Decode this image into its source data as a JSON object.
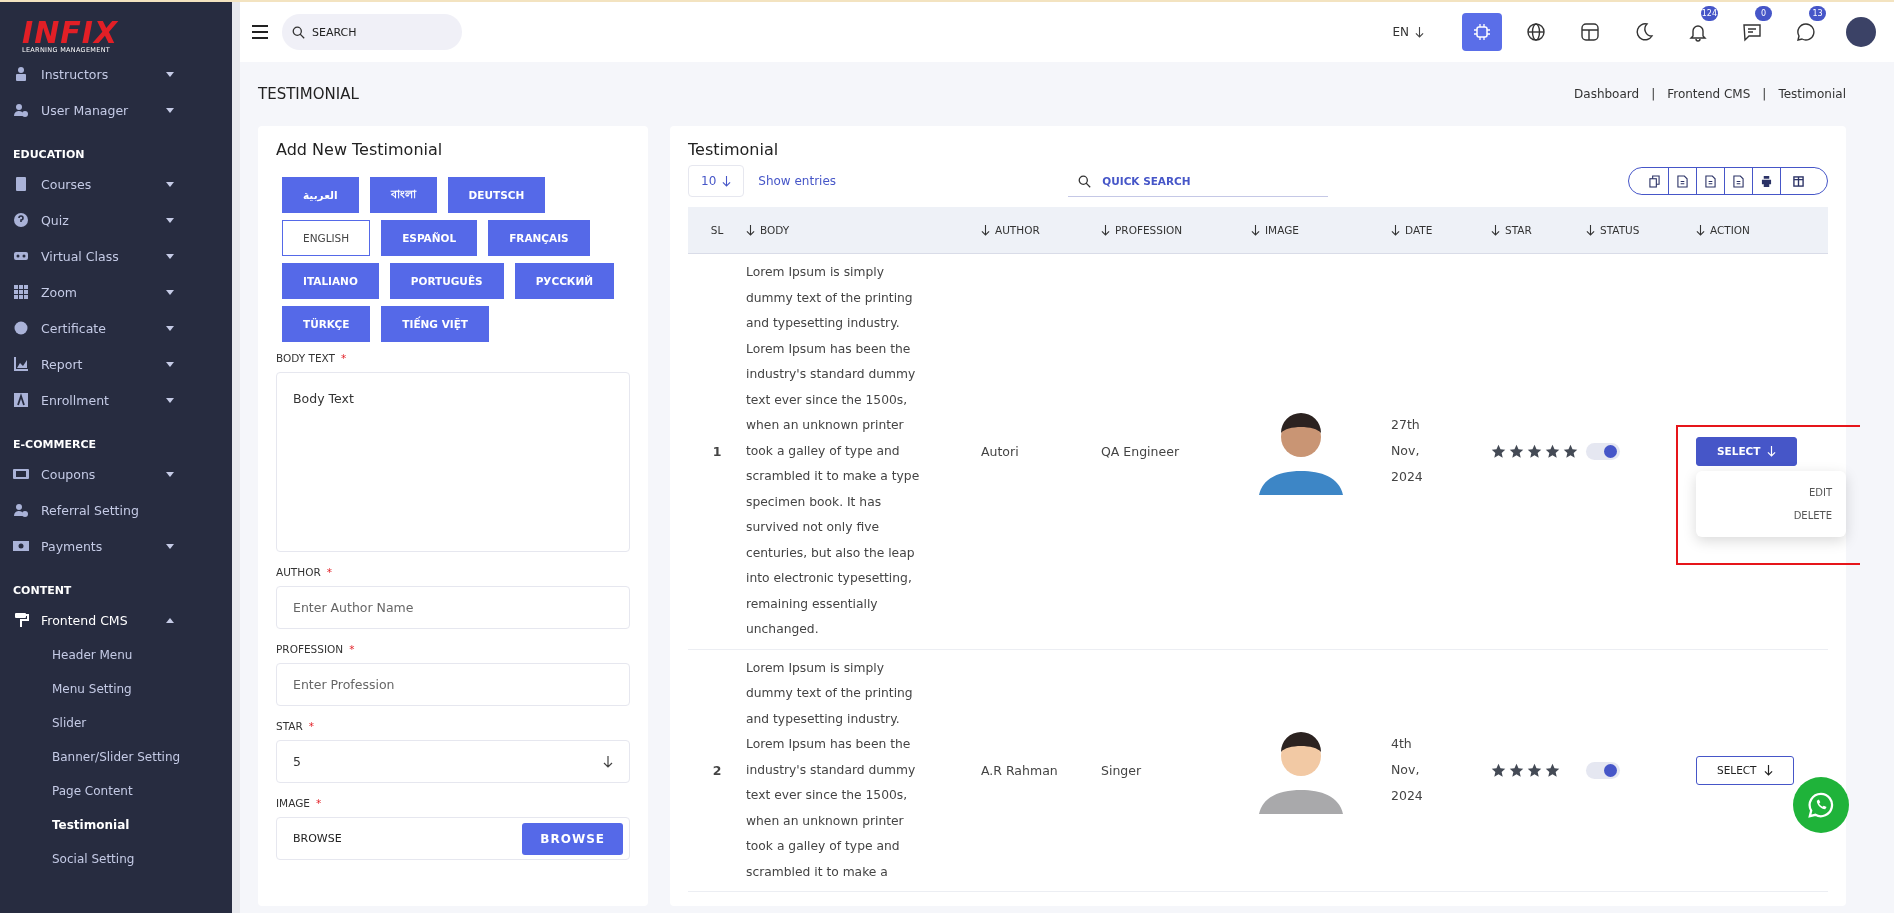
{
  "sidebar": {
    "logo": {
      "name": "INFIX",
      "tagline": "LEARNING MANAGEMENT"
    },
    "sections": [
      {
        "items": [
          {
            "label": "Instructors",
            "kind": "group",
            "expanded": false
          },
          {
            "label": "User Manager",
            "kind": "group",
            "expanded": false
          }
        ]
      },
      {
        "heading": "EDUCATION",
        "items": [
          {
            "label": "Courses",
            "kind": "group",
            "expanded": false
          },
          {
            "label": "Quiz",
            "kind": "group",
            "expanded": false
          },
          {
            "label": "Virtual Class",
            "kind": "group",
            "expanded": false
          },
          {
            "label": "Zoom",
            "kind": "group",
            "expanded": false
          },
          {
            "label": "Certificate",
            "kind": "group",
            "expanded": false
          },
          {
            "label": "Report",
            "kind": "group",
            "expanded": false
          },
          {
            "label": "Enrollment",
            "kind": "group",
            "expanded": false
          }
        ]
      },
      {
        "heading": "E-COMMERCE",
        "items": [
          {
            "label": "Coupons",
            "kind": "group",
            "expanded": false
          },
          {
            "label": "Referral Setting",
            "kind": "link",
            "expanded": false
          },
          {
            "label": "Payments",
            "kind": "group",
            "expanded": false
          }
        ]
      },
      {
        "heading": "CONTENT",
        "items": [
          {
            "label": "Frontend CMS",
            "kind": "group",
            "expanded": true,
            "children": [
              {
                "label": "Header Menu",
                "selected": false
              },
              {
                "label": "Menu Setting",
                "selected": false
              },
              {
                "label": "Slider",
                "selected": false
              },
              {
                "label": "Banner/Slider Setting",
                "selected": false
              },
              {
                "label": "Page Content",
                "selected": false
              },
              {
                "label": "Testimonial",
                "selected": true
              },
              {
                "label": "Social Setting",
                "selected": false
              }
            ]
          }
        ]
      }
    ]
  },
  "topbar": {
    "search": {
      "placeholder": "SEARCH"
    },
    "language": "EN",
    "icons": [
      {
        "kind": "chip",
        "selected": true
      },
      {
        "kind": "globe",
        "selected": false
      },
      {
        "kind": "layout",
        "selected": false
      },
      {
        "kind": "moon",
        "selected": false
      },
      {
        "kind": "bell",
        "selected": false,
        "badge": "124"
      },
      {
        "kind": "chat",
        "selected": false,
        "badge": "0"
      },
      {
        "kind": "whatsapp",
        "selected": false,
        "badge": "13"
      }
    ]
  },
  "page": {
    "title": "TESTIMONIAL",
    "breadcrumb": [
      "Dashboard",
      "Frontend CMS",
      "Testimonial"
    ],
    "breadcrumb_separator": "|"
  },
  "form": {
    "title": "Add New Testimonial",
    "languages": [
      {
        "label": "العربية",
        "selected": false
      },
      {
        "label": "বাংলা",
        "selected": false
      },
      {
        "label": "DEUTSCH",
        "selected": false
      },
      {
        "label": "ENGLISH",
        "selected": true
      },
      {
        "label": "ESPAÑOL",
        "selected": false
      },
      {
        "label": "FRANÇAIS",
        "selected": false
      },
      {
        "label": "ITALIANO",
        "selected": false
      },
      {
        "label": "PORTUGUÊS",
        "selected": false
      },
      {
        "label": "РУССКИЙ",
        "selected": false
      },
      {
        "label": "TÜRKÇE",
        "selected": false
      },
      {
        "label": "TIẾNG VIỆT",
        "selected": false
      }
    ],
    "fields": [
      {
        "kind": "textarea",
        "label": "BODY TEXT",
        "required_mark": "*",
        "placeholder": "Body Text"
      },
      {
        "kind": "text",
        "label": "AUTHOR",
        "required_mark": "*",
        "placeholder": "Enter Author Name"
      },
      {
        "kind": "text",
        "label": "PROFESSION",
        "required_mark": "*",
        "placeholder": "Enter Profession"
      },
      {
        "kind": "select",
        "label": "STAR",
        "required_mark": "*",
        "value": "5"
      },
      {
        "kind": "file",
        "label": "IMAGE",
        "required_mark": "*",
        "placeholder": "BROWSE",
        "button": "BROWSE"
      }
    ]
  },
  "table": {
    "title": "Testimonial",
    "page_size": "10",
    "show_entries": "Show entries",
    "search": {
      "placeholder": "QUICK SEARCH"
    },
    "export_buttons": [
      {
        "kind": "copy"
      },
      {
        "kind": "excel"
      },
      {
        "kind": "csv"
      },
      {
        "kind": "pdf"
      },
      {
        "kind": "print"
      },
      {
        "kind": "columns"
      }
    ],
    "columns": [
      {
        "label": "SL",
        "sortable": false
      },
      {
        "label": "BODY",
        "sortable": true
      },
      {
        "label": "AUTHOR",
        "sortable": true
      },
      {
        "label": "PROFESSION",
        "sortable": true
      },
      {
        "label": "IMAGE",
        "sortable": true
      },
      {
        "label": "DATE",
        "sortable": true
      },
      {
        "label": "STAR",
        "sortable": true
      },
      {
        "label": "STATUS",
        "sortable": true
      },
      {
        "label": "ACTION",
        "sortable": true
      }
    ],
    "rows": [
      {
        "sl": "1",
        "body": "Lorem Ipsum is simply dummy text of the printing and typesetting industry. Lorem Ipsum has been the industry's standard dummy text ever since the 1500s, when an unknown printer took a galley of type and scrambled it to make a type specimen book. It has survived not only five centuries, but also the leap into electronic typesetting, remaining essentially unchanged.",
        "author": "Autori",
        "profession": "QA Engineer",
        "date": "27th Nov, 2024",
        "stars": 5,
        "status_on": true,
        "action": "SELECT",
        "menu_open": true,
        "menu": [
          "EDIT",
          "DELETE"
        ]
      },
      {
        "sl": "2",
        "body": "Lorem Ipsum is simply dummy text of the printing and typesetting industry. Lorem Ipsum has been the industry's standard dummy text ever since the 1500s, when an unknown printer took a galley of type and scrambled it to make a",
        "author": "A.R Rahman",
        "profession": "Singer",
        "date": "4th Nov, 2024",
        "stars": 4,
        "status_on": true,
        "action": "SELECT",
        "menu_open": false,
        "menu": []
      }
    ]
  }
}
